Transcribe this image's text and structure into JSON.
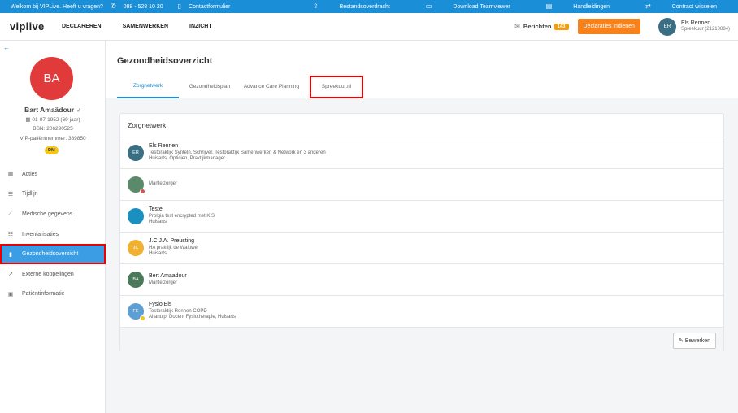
{
  "topbar": {
    "welcome": "Welkom bij VIPLive. Heeft u vragen?",
    "phone": "088 - 528 10 20",
    "contact": "Contactformulier",
    "links": [
      {
        "label": "Bestandsoverdracht",
        "icon": "upload-icon"
      },
      {
        "label": "Download Teamviewer",
        "icon": "monitor-icon"
      },
      {
        "label": "Handleidingen",
        "icon": "book-icon"
      },
      {
        "label": "Contract wisselen",
        "icon": "switch-icon"
      }
    ]
  },
  "header": {
    "logo": "viplive",
    "nav": [
      "DECLAREREN",
      "SAMENWERKEN",
      "INZICHT"
    ],
    "berichten_label": "Berichten",
    "berichten_count": "143",
    "declaraties_button": "Declaraties indienen",
    "user": {
      "initials": "ER",
      "name": "Els Rennen",
      "sub": "Spreekuur (21210884)"
    }
  },
  "patient": {
    "initials": "BA",
    "name": "Bart Amaädour ♂",
    "dob": "01-07-1952 (69 jaar)",
    "bsn": "BSN: 206290525",
    "vip": "VIP-patiëntnummer: 389850",
    "badge": "DM"
  },
  "sidebar": {
    "items": [
      {
        "label": "Acties",
        "icon": "calendar-icon"
      },
      {
        "label": "Tijdlijn",
        "icon": "list-icon"
      },
      {
        "label": "Medische gegevens",
        "icon": "chart-icon"
      },
      {
        "label": "Inventarisaties",
        "icon": "checklist-icon"
      },
      {
        "label": "Gezondheidsoverzicht",
        "icon": "document-icon"
      },
      {
        "label": "Externe koppelingen",
        "icon": "external-link-icon"
      },
      {
        "label": "Patiëntinformatie",
        "icon": "id-card-icon"
      }
    ]
  },
  "main": {
    "title": "Gezondheidsoverzicht",
    "tabs": [
      "Zorgnetwerk",
      "Gezondheidsplan",
      "Advance Care Planning",
      "Spreekuur.nl"
    ]
  },
  "card": {
    "title": "Zorgnetwerk",
    "rows": [
      {
        "initials": "ER",
        "color": "#3a6e82",
        "name": "Els Rennen",
        "line1": "Testpraktijk Synteln, Schrijver, Testpraktijk Samenwerken & Network en 3 anderen",
        "line2": "Huisarts, Opticien, Praktijkmanager"
      },
      {
        "initials": "",
        "color": "#5a8a6a",
        "name": "",
        "line1": "Mantelzorger",
        "line2": ""
      },
      {
        "initials": "",
        "color": "#1a8fc0",
        "name": "Teste",
        "line1": "Prolgia test encrypted met KIS",
        "line2": "Huisarts"
      },
      {
        "initials": "JC",
        "color": "#f0b030",
        "name": "J.C.J.A. Preusting",
        "line1": "HA praktijk de Waluwe",
        "line2": "Huisarts"
      },
      {
        "initials": "BA",
        "color": "#4a7a5a",
        "name": "Bert Amaadour",
        "line1": "Mantelzorger",
        "line2": ""
      },
      {
        "initials": "FE",
        "color": "#5b9fd4",
        "name": "Fysio Els",
        "line1": "Testpraktijk Rennen COPD",
        "line2": "Alfanulp, Docent Fysiotherapie, Huisarts"
      }
    ],
    "edit_button": "Bewerken"
  }
}
